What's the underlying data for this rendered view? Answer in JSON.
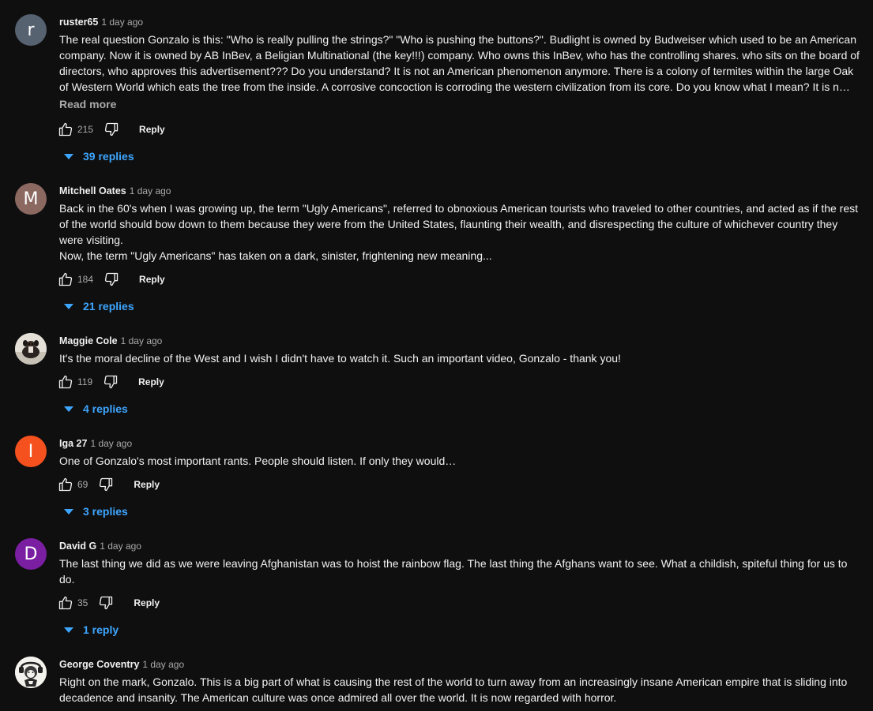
{
  "comments": [
    {
      "author": "ruster65",
      "time": "1 day ago",
      "avatar": {
        "kind": "letter",
        "letter": "r",
        "color": "#56626f"
      },
      "text": "The real question Gonzalo is this:  \"Who is really pulling the strings?\"  \"Who is pushing the buttons?\".  Budlight is owned by Budweiser which used to be an American company.  Now it is owned by AB InBev, a Beligian Multinational (the key!!!) company.  Who owns this InBev, who has the controlling shares. who sits on the board of directors, who approves this advertisement???  Do you understand?  It is not an American phenomenon anymore.  There is a colony of termites within the large Oak of Western World which eats the tree from the inside.  A corrosive concoction is corroding the western civilization from its core.  Do you know what I mean?  It is n…",
      "read_more": "Read more",
      "likes": "215",
      "reply_label": "Reply",
      "replies": "39 replies"
    },
    {
      "author": "Mitchell Oates",
      "time": "1 day ago",
      "avatar": {
        "kind": "letter",
        "letter": "M",
        "color": "#8b6961"
      },
      "paragraphs": [
        "Back in the 60's when I was growing up, the term \"Ugly Americans\", referred to obnoxious American tourists who traveled to other countries, and acted as if the rest of the world should bow down to them because they were from the United States, flaunting their wealth, and disrespecting the culture of whichever country they were visiting.",
        "Now, the term \"Ugly Americans\" has taken on a dark, sinister, frightening new meaning..."
      ],
      "likes": "184",
      "reply_label": "Reply",
      "replies": "21 replies"
    },
    {
      "author": "Maggie Cole",
      "time": "1 day ago",
      "avatar": {
        "kind": "image",
        "icon": "dog-photo"
      },
      "text": "It's the moral decline of the West and I wish I didn't have to watch it. Such an important video, Gonzalo - thank you!",
      "likes": "119",
      "reply_label": "Reply",
      "replies": "4 replies"
    },
    {
      "author": "Iga 27",
      "time": "1 day ago",
      "avatar": {
        "kind": "letter",
        "letter": "I",
        "color": "#f4511e"
      },
      "text": "One of Gonzalo's most important rants. People should listen. If only they would…",
      "likes": "69",
      "reply_label": "Reply",
      "replies": "3 replies"
    },
    {
      "author": "David G",
      "time": "1 day ago",
      "avatar": {
        "kind": "letter",
        "letter": "D",
        "color": "#7b1fa2"
      },
      "text": "The last thing we did as we were leaving Afghanistan was to hoist the rainbow flag. The last thing the Afghans want to see. What a childish, spiteful thing for us to do.",
      "likes": "35",
      "reply_label": "Reply",
      "replies": "1 reply"
    },
    {
      "author": "George Coventry",
      "time": "1 day ago",
      "avatar": {
        "kind": "image",
        "icon": "monkey-drawing"
      },
      "text": "Right on the mark, Gonzalo.  This is a big part of what is causing the rest of the world to turn away from an increasingly insane American empire that is sliding into decadence and insanity.  The American culture was once admired all over the world.  It is now regarded with horror."
    }
  ],
  "theme": {
    "link_blue": "#3ea6ff",
    "meta_gray": "#aaaaaa",
    "background": "#0f0f0f"
  }
}
